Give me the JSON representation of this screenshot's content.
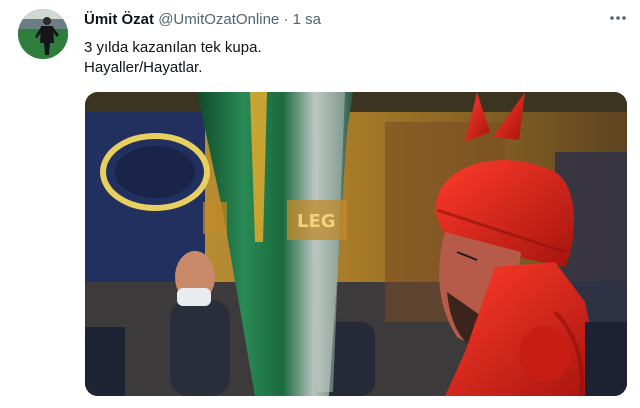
{
  "tweet": {
    "author_name": "Ümit Özat",
    "handle": "@UmitOzatOnline",
    "separator": "·",
    "time": "1 sa",
    "text_lines": [
      "3 yılda kazanılan tek kupa.",
      "Hayaller/Hayatlar."
    ],
    "more_icon": "more-dots-icon",
    "media": {
      "kind": "photo",
      "cup_inscription": "LEG"
    }
  },
  "colors": {
    "name": "#0f1419",
    "secondary": "#536471",
    "devil_red": "#d9261c",
    "cup_green": "#1f7a48"
  }
}
